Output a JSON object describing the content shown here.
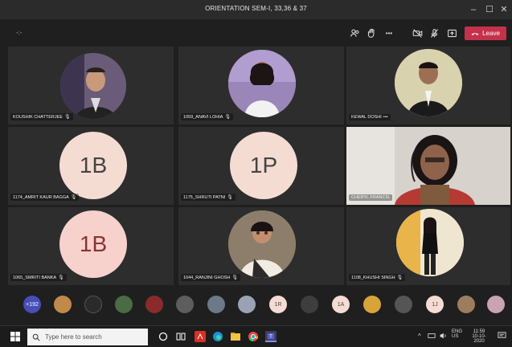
{
  "window": {
    "title": "ORIENTATION SEM-I, 33,36 & 37",
    "minimize": "–",
    "maximize": "☐",
    "close": "✕"
  },
  "toolbar": {
    "timer": "-:-",
    "leave_label": "Leave",
    "more_label": "•••"
  },
  "participants": [
    {
      "name": "KOUSHIK CHATTERJEE",
      "type": "photo"
    },
    {
      "name": "1059_ANAVI LOHIA",
      "type": "photo"
    },
    {
      "name": "KEWAL DOSHI",
      "type": "photo",
      "more": "•••"
    },
    {
      "name": "1174_AMRIT KAUR BAGGA",
      "type": "initials",
      "initials": "1B"
    },
    {
      "name": "1175_SHRUTI PATNI",
      "type": "initials",
      "initials": "1P"
    },
    {
      "name": "CHERYL FRANCIS",
      "type": "video"
    },
    {
      "name": "1065_SMRITI BANKA",
      "type": "initials",
      "initials": "1B"
    },
    {
      "name": "1044_RANJINI GHOSH",
      "type": "photo"
    },
    {
      "name": "1108_KHUSHI SINGH",
      "type": "photo"
    }
  ],
  "strip": {
    "overflow_count": "+192",
    "initial_avatars": [
      "1R",
      "1A",
      "1J"
    ]
  },
  "taskbar": {
    "search_placeholder": "Type here to search",
    "language": "ENG",
    "region": "US",
    "time": "11:59",
    "date": "10-10-2020"
  },
  "colors": {
    "leave_button": "#c4314b",
    "overflow_avatar": "#464eb8",
    "initials_bg": "#f5dcd3"
  }
}
